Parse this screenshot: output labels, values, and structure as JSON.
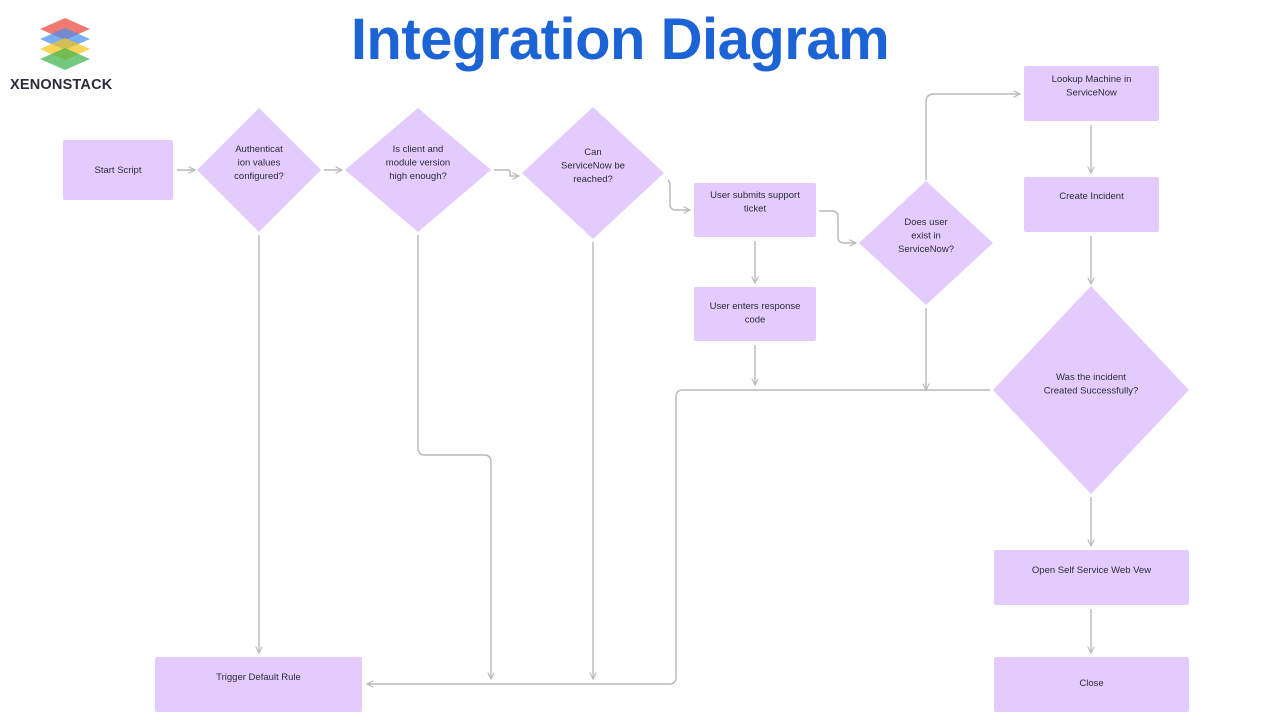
{
  "brand": {
    "name": "XENONSTACK",
    "layer_colors": [
      "#e8473c",
      "#4a8ff0",
      "#f5c518",
      "#3fb34f"
    ]
  },
  "title": "Integration Diagram",
  "colors": {
    "title": "#1c63d6",
    "node_fill": "#e3ccfd",
    "edge": "#b8b8b8",
    "text": "#2b2b3a"
  },
  "nodes": {
    "start_script": {
      "type": "process",
      "lines": [
        "Start Script"
      ]
    },
    "auth_configured": {
      "type": "decision",
      "lines": [
        "Authenticat",
        "ion values",
        "configured?"
      ]
    },
    "version_check": {
      "type": "decision",
      "lines": [
        "Is client and",
        "module version",
        "high enough?"
      ]
    },
    "servicenow_reachable": {
      "type": "decision",
      "lines": [
        "Can",
        "ServiceNow be",
        "reached?"
      ]
    },
    "submit_ticket": {
      "type": "process",
      "lines": [
        "User submits support",
        "ticket"
      ]
    },
    "response_code": {
      "type": "process",
      "lines": [
        "User enters response",
        "code"
      ]
    },
    "user_exists": {
      "type": "decision",
      "lines": [
        "Does user",
        "exist in",
        "ServiceNow?"
      ]
    },
    "lookup_machine": {
      "type": "process",
      "lines": [
        "Lookup Machine in",
        "ServiceNow"
      ]
    },
    "create_incident": {
      "type": "process",
      "lines": [
        "Create Incident"
      ]
    },
    "incident_success": {
      "type": "decision",
      "lines": [
        "Was the incident",
        "Created Successfully?"
      ]
    },
    "open_web_view": {
      "type": "process",
      "lines": [
        "Open Self Service Web Vew"
      ]
    },
    "close": {
      "type": "process",
      "lines": [
        "Close"
      ]
    },
    "default_rule": {
      "type": "process",
      "lines": [
        "Trigger Default Rule"
      ]
    }
  },
  "edges": [
    {
      "from": "start_script",
      "to": "auth_configured"
    },
    {
      "from": "auth_configured",
      "to": "version_check"
    },
    {
      "from": "version_check",
      "to": "servicenow_reachable"
    },
    {
      "from": "servicenow_reachable",
      "to": "submit_ticket"
    },
    {
      "from": "submit_ticket",
      "to": "response_code"
    },
    {
      "from": "submit_ticket",
      "to": "user_exists"
    },
    {
      "from": "user_exists",
      "to": "lookup_machine"
    },
    {
      "from": "lookup_machine",
      "to": "create_incident"
    },
    {
      "from": "create_incident",
      "to": "incident_success"
    },
    {
      "from": "incident_success",
      "to": "open_web_view"
    },
    {
      "from": "open_web_view",
      "to": "close"
    },
    {
      "from": "auth_configured",
      "to": "default_rule"
    },
    {
      "from": "version_check",
      "to": "default_rule"
    },
    {
      "from": "servicenow_reachable",
      "to": "default_rule"
    },
    {
      "from": "response_code",
      "to": "default_rule"
    },
    {
      "from": "user_exists",
      "to": "default_rule"
    },
    {
      "from": "incident_success",
      "to": "default_rule"
    }
  ]
}
